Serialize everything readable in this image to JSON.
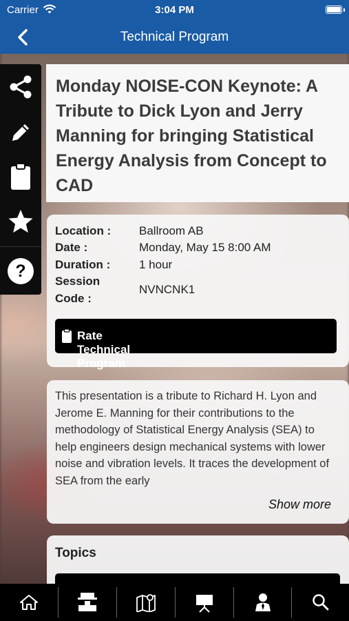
{
  "status_bar": {
    "carrier": "Carrier",
    "time": "3:04 PM"
  },
  "nav": {
    "title": "Technical Program",
    "back_icon": "chevron-left-icon"
  },
  "side_toolbar": {
    "items": [
      {
        "icon": "share-icon"
      },
      {
        "icon": "pencil-icon"
      },
      {
        "icon": "clipboard-icon"
      },
      {
        "icon": "star-icon"
      },
      {
        "icon": "help-icon"
      }
    ]
  },
  "session": {
    "title": "Monday NOISE-CON Keynote: A Tribute to Dick Lyon and Jerry Manning for bringing Statistical Energy Analysis from Concept to CAD",
    "location_label": "Location :",
    "location": "Ballroom AB",
    "date_label": "Date :",
    "date": "Monday, May 15 8:00 AM",
    "duration_label": "Duration :",
    "duration": "1 hour",
    "code_label_1": "Session",
    "code_label_2": "Code :",
    "code": "NVNCNK1",
    "rate_button": "Rate Technical Program"
  },
  "description": {
    "text": "This presentation is a tribute to Richard H. Lyon and Jerome E. Manning for their contributions to the methodology of Statistical Energy Analysis (SEA) to help engineers design mechanical systems with lower noise and vibration levels. It traces the development of SEA from the early",
    "show_more": "Show more"
  },
  "topics": {
    "heading": "Topics"
  },
  "tab_bar": {
    "items": [
      {
        "icon": "home-icon"
      },
      {
        "icon": "exhibitor-booth-icon"
      },
      {
        "icon": "map-icon"
      },
      {
        "icon": "presentation-icon"
      },
      {
        "icon": "attendee-icon"
      },
      {
        "icon": "search-icon"
      }
    ]
  },
  "colors": {
    "header_blue": "#1a5ba6",
    "toolbar_black": "#0d0d0d",
    "card_bg": "#f7f7f7"
  }
}
